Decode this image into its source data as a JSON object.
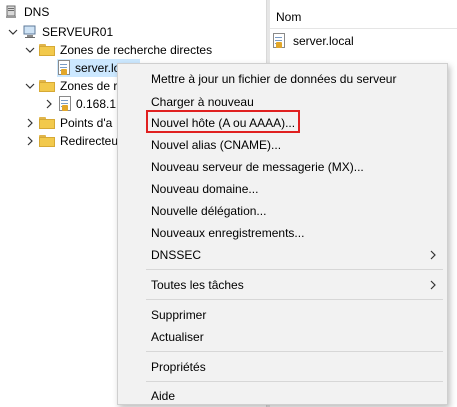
{
  "tree": {
    "root_label": "DNS",
    "server_label": "SERVEUR01",
    "forward_zones_label": "Zones de recherche directes",
    "zone_label": "server.local",
    "reverse_zones_label": "Zones de re",
    "reverse_sub_label": "0.168.1",
    "trust_points_label": "Points d'a",
    "forwarders_label": "Redirecteu"
  },
  "list": {
    "column_name": "Nom",
    "items": [
      "server.local"
    ]
  },
  "context_menu": {
    "items": [
      "Mettre à jour un fichier de données du serveur",
      "Charger à nouveau",
      "Nouvel hôte (A ou AAAA)...",
      "Nouvel alias (CNAME)...",
      "Nouveau serveur de messagerie (MX)...",
      "Nouveau domaine...",
      "Nouvelle délégation...",
      "Nouveaux enregistrements...",
      "DNSSEC",
      "Toutes les tâches",
      "Supprimer",
      "Actualiser",
      "Propriétés",
      "Aide"
    ],
    "highlighted_item": "Nouvel hôte (A ou AAAA)...",
    "highlight_color": "#e02020"
  }
}
